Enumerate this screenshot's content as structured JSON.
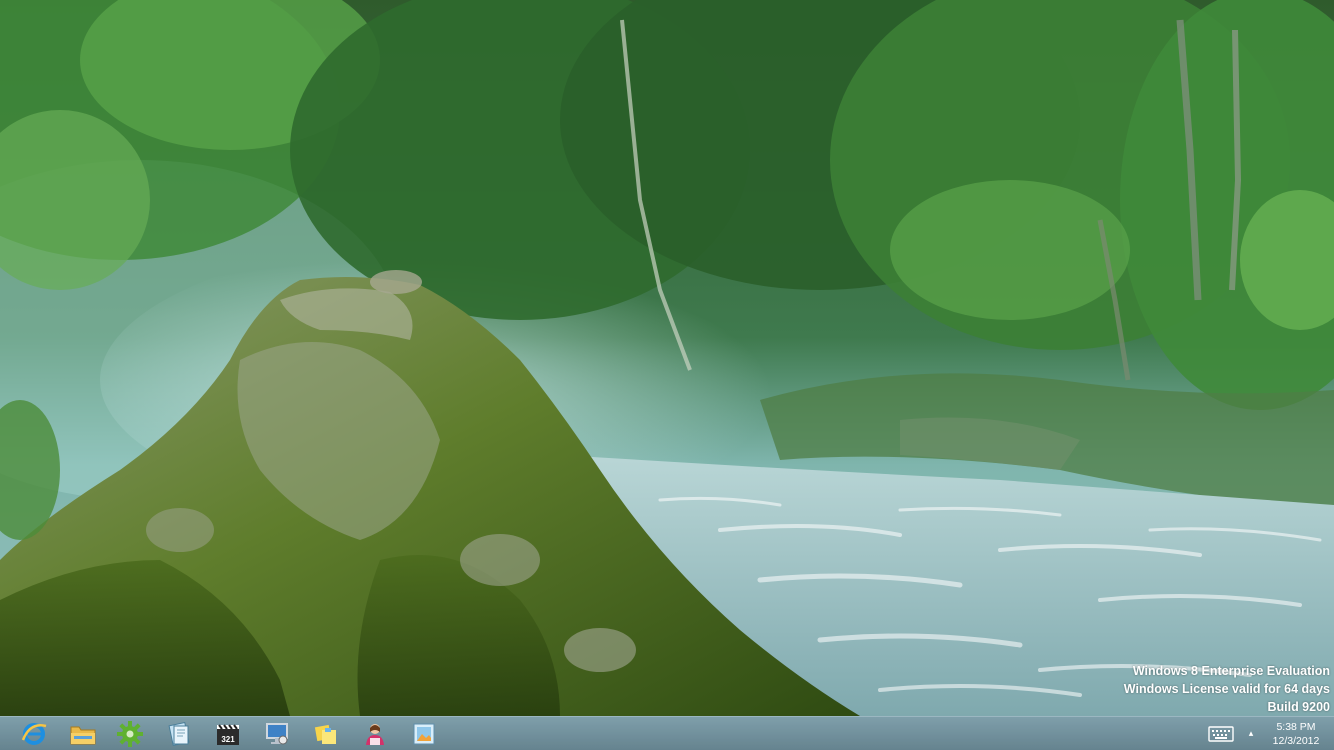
{
  "desktop": {
    "wallpaper_icon": "forest-river-rock-wallpaper",
    "watermark": {
      "line1": "Windows 8 Enterprise Evaluation",
      "line2": "Windows License valid for 64 days",
      "line3": "Build 9200"
    }
  },
  "taskbar": {
    "background_color": "#6f8d9b",
    "pinned": [
      {
        "name": "internet-explorer",
        "icon": "ie-icon"
      },
      {
        "name": "file-explorer",
        "icon": "folder-icon"
      },
      {
        "name": "settings-app",
        "icon": "gear-icon"
      },
      {
        "name": "notes-app",
        "icon": "notepad-icon"
      },
      {
        "name": "media-app",
        "icon": "clapperboard-icon"
      },
      {
        "name": "remote-desktop",
        "icon": "monitor-icon"
      },
      {
        "name": "sticky-notes",
        "icon": "sticky-notes-icon"
      },
      {
        "name": "user-app",
        "icon": "user-icon"
      },
      {
        "name": "picture-app",
        "icon": "picture-icon"
      }
    ],
    "clapperboard_label": "321",
    "tray": {
      "keyboard_icon": "keyboard-icon",
      "chevron": "▴",
      "time": "5:38 PM",
      "date": "12/3/2012"
    }
  }
}
